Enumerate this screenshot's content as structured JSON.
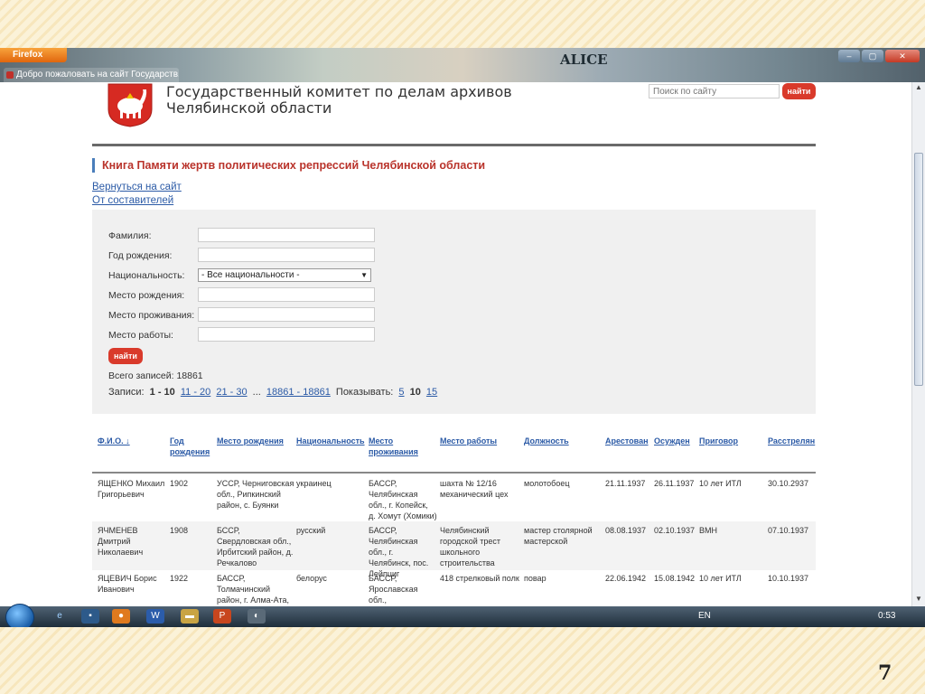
{
  "browser": {
    "app_button": "Firefox",
    "tab_title": "Добро пожаловать на сайт Государств...",
    "banner_text": "ALICE",
    "controls": {
      "minimize": "–",
      "maximize": "▢",
      "close": "✕"
    }
  },
  "header": {
    "site_title_line1": "Государственный комитет по делам архивов",
    "site_title_line2": "Челябинской области",
    "search_placeholder": "Поиск по сайту",
    "search_button": "найти"
  },
  "section": {
    "heading": "Книга Памяти жертв политических репрессий Челябинской области",
    "link_back": "Вернуться на сайт",
    "link_authors": "От составителей"
  },
  "form": {
    "labels": {
      "surname": "Фамилия:",
      "birth_year": "Год рождения:",
      "nationality": "Национальность:",
      "birth_place": "Место рождения:",
      "residence": "Место проживания:",
      "work_place": "Место работы:"
    },
    "nationality_selected": "- Все национальности -",
    "search_button": "найти",
    "total_text": "Всего записей: 18861",
    "pager": {
      "prefix": "Записи:",
      "current": "1 - 10",
      "next": "11 - 20",
      "next2": "21 - 30",
      "ellipsis": "...",
      "last": "18861 - 18861",
      "show_label": "Показывать:",
      "size5": "5",
      "size10": "10",
      "size15": "15"
    }
  },
  "table": {
    "columns": [
      "Ф.И.О. ↓",
      "Год рождения",
      "Место рождения",
      "Национальность",
      "Место проживания",
      "Место работы",
      "Должность",
      "Арестован",
      "Осужден",
      "Приговор",
      "Расстрелян"
    ],
    "rows": [
      [
        "ЯЩЕНКО Михаил Григорьевич",
        "1902",
        "УССР, Черниговская обл., Рипкинский район, с. Буянки",
        "украинец",
        "БАССР, Челябинская обл., г. Копейск, д. Хомут (Хомики)",
        "шахта № 12/16 механический цех",
        "молотобоец",
        "21.11.1937",
        "26.11.1937",
        "10 лет ИТЛ",
        "30.10.2937"
      ],
      [
        "ЯЧМЕНЕВ Дмитрий Николаевич",
        "1908",
        "БССР, Свердловская обл., Ирбитский район, д. Речкалово",
        "русский",
        "БАССР, Челябинская обл., г. Челябинск, пос. Лейпциг",
        "Челябинский городской трест школьного строительства",
        "мастер столярной мастерской",
        "08.08.1937",
        "02.10.1937",
        "ВМН",
        "07.10.1937"
      ],
      [
        "ЯЦЕВИЧ Борис Иванович",
        "1922",
        "БАССР, Толмачинский район, г. Алма-Ата,",
        "белорус",
        "БАССР, Ярославская обл.,",
        "418 стрелковый полк",
        "повар",
        "22.06.1942",
        "15.08.1942",
        "10 лет ИТЛ",
        "10.10.1937"
      ]
    ]
  },
  "taskbar": {
    "lang": "EN",
    "clock": "0:53"
  },
  "slide": {
    "number": "7"
  }
}
